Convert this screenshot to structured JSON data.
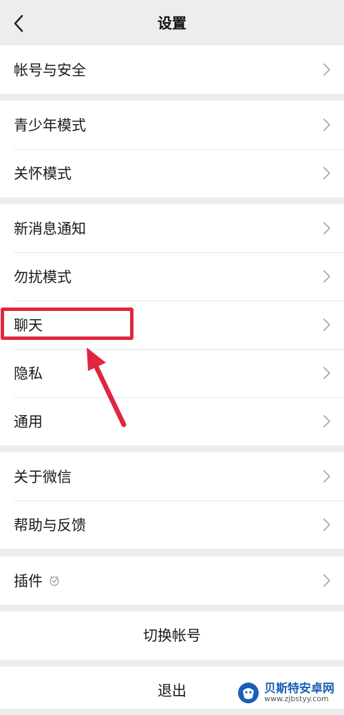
{
  "nav": {
    "title": "设置"
  },
  "groups": [
    {
      "items": [
        {
          "label": "帐号与安全"
        }
      ]
    },
    {
      "items": [
        {
          "label": "青少年模式"
        },
        {
          "label": "关怀模式"
        }
      ]
    },
    {
      "items": [
        {
          "label": "新消息通知"
        },
        {
          "label": "勿扰模式"
        },
        {
          "label": "聊天"
        },
        {
          "label": "隐私"
        },
        {
          "label": "通用"
        }
      ]
    },
    {
      "items": [
        {
          "label": "关于微信"
        },
        {
          "label": "帮助与反馈"
        }
      ]
    },
    {
      "items": [
        {
          "label": "插件"
        }
      ]
    }
  ],
  "actions": {
    "switch_account": "切换帐号",
    "logout": "退出"
  },
  "annotation": {
    "highlight_color": "#e0263f",
    "highlighted_item": "聊天"
  },
  "watermark": {
    "name": "贝斯特安卓网",
    "url": "www.zjbstyy.com",
    "color": "#1a5fb4"
  },
  "icons": {
    "back": "chevron-left-icon",
    "row_chevron": "chevron-right-icon",
    "plugin": "plugin-badge-icon"
  }
}
